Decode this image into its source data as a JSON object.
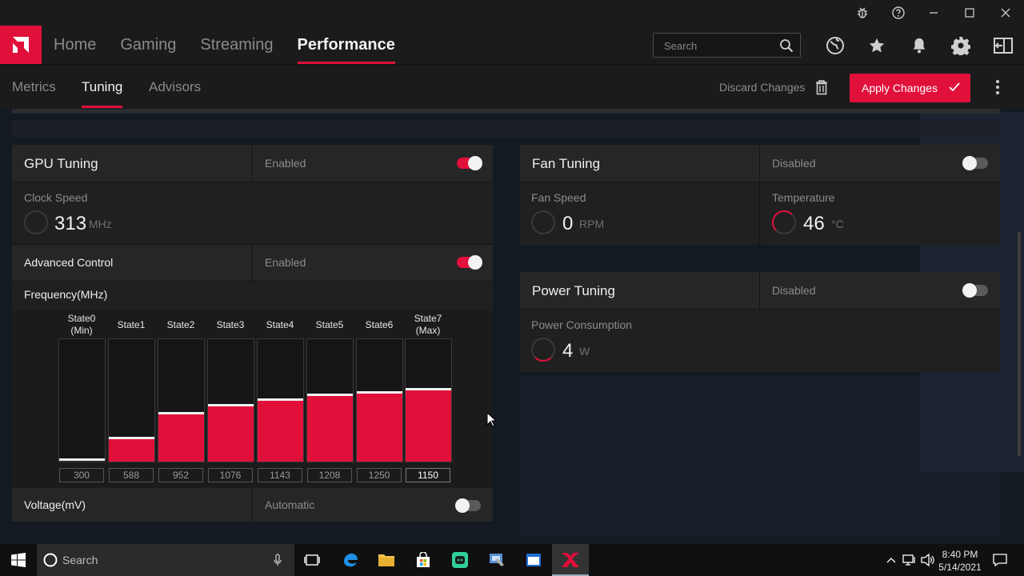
{
  "window_controls": [
    "bug-report-icon",
    "help-icon",
    "minimize-icon",
    "maximize-icon",
    "close-icon"
  ],
  "nav": {
    "tabs": [
      {
        "label": "Home",
        "active": false
      },
      {
        "label": "Gaming",
        "active": false
      },
      {
        "label": "Streaming",
        "active": false
      },
      {
        "label": "Performance",
        "active": true
      }
    ],
    "search_placeholder": "Search",
    "icons": [
      "globe-icon",
      "star-icon",
      "bell-icon",
      "gear-icon",
      "layout-icon"
    ]
  },
  "subnav": {
    "tabs": [
      {
        "label": "Metrics",
        "active": false
      },
      {
        "label": "Tuning",
        "active": true
      },
      {
        "label": "Advisors",
        "active": false
      }
    ],
    "discard_label": "Discard Changes",
    "apply_label": "Apply Changes"
  },
  "gpu_tuning": {
    "title": "GPU Tuning",
    "state": "Enabled",
    "enabled": true,
    "clock_label": "Clock Speed",
    "clock_value": "313",
    "clock_unit": "MHz"
  },
  "advanced_control": {
    "title": "Advanced Control",
    "state": "Enabled",
    "enabled": true
  },
  "frequency": {
    "title": "Frequency(MHz)",
    "states": [
      {
        "label": "State0\n(Min)",
        "value": "300",
        "level": 0.0
      },
      {
        "label": "State1",
        "value": "588",
        "level": 0.19
      },
      {
        "label": "State2",
        "value": "952",
        "level": 0.39
      },
      {
        "label": "State3",
        "value": "1076",
        "level": 0.46
      },
      {
        "label": "State4",
        "value": "1143",
        "level": 0.5
      },
      {
        "label": "State5",
        "value": "1208",
        "level": 0.54
      },
      {
        "label": "State6",
        "value": "1250",
        "level": 0.56
      },
      {
        "label": "State7\n(Max)",
        "value": "1150",
        "level": 0.59
      }
    ]
  },
  "voltage": {
    "title": "Voltage(mV)",
    "state": "Automatic",
    "enabled": false
  },
  "fan_tuning": {
    "title": "Fan Tuning",
    "state": "Disabled",
    "enabled": false,
    "fan_label": "Fan Speed",
    "fan_value": "0",
    "fan_unit": "RPM",
    "temp_label": "Temperature",
    "temp_value": "46",
    "temp_unit": "°C"
  },
  "power_tuning": {
    "title": "Power Tuning",
    "state": "Disabled",
    "enabled": false,
    "power_label": "Power Consumption",
    "power_value": "4",
    "power_unit": "W"
  },
  "taskbar": {
    "search_placeholder": "Search",
    "time": "8:40 PM",
    "date": "5/14/2021"
  },
  "colors": {
    "accent": "#e0103a",
    "background": "#1b1b1c",
    "card": "#202021"
  }
}
